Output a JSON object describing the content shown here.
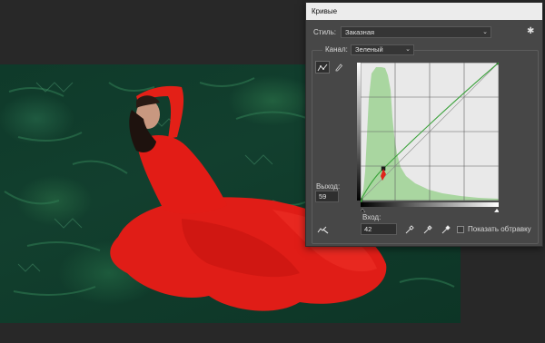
{
  "dialog": {
    "title": "Кривые",
    "preset_label": "Стиль:",
    "preset_value": "Заказная",
    "channel_label": "Канал:",
    "channel_value": "Зеленый",
    "output_label": "Выход:",
    "output_value": "59",
    "input_label": "Вход:",
    "input_value": "42",
    "show_clipping_label": "Показать обтравку",
    "show_clipping_checked": false
  },
  "curve": {
    "points": [
      [
        0,
        0
      ],
      [
        42,
        59
      ],
      [
        255,
        255
      ]
    ],
    "channel_color": "#3aa23a",
    "histogram_color": "#a9d6a0"
  },
  "icons": {
    "settings": "gear-icon",
    "curve_tool": "curve-point-tool-icon",
    "pencil_tool": "pencil-icon",
    "on_image_adjust": "on-image-adjust-icon",
    "black_point": "black-eyedropper-icon",
    "gray_point": "gray-eyedropper-icon",
    "white_point": "white-eyedropper-icon"
  }
}
